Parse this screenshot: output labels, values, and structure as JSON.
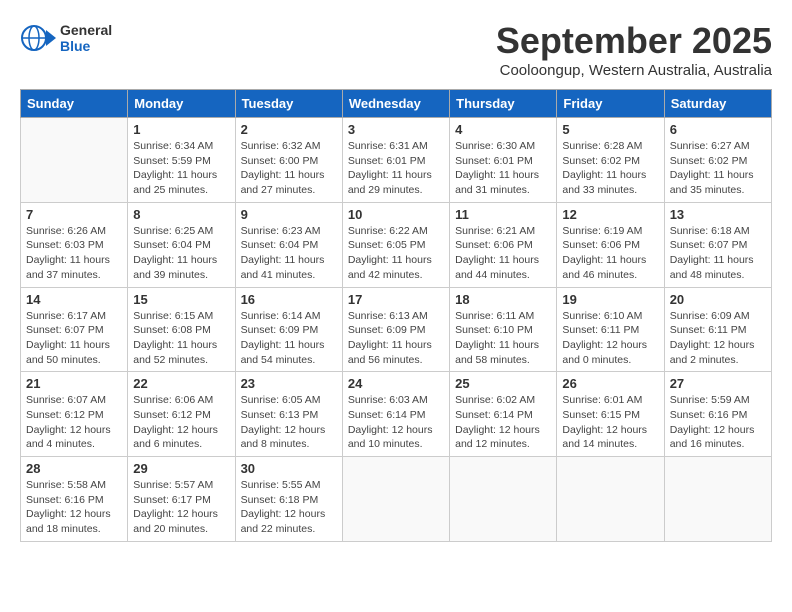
{
  "logo": {
    "text_general": "General",
    "text_blue": "Blue"
  },
  "header": {
    "month": "September 2025",
    "location": "Cooloongup, Western Australia, Australia"
  },
  "days_of_week": [
    "Sunday",
    "Monday",
    "Tuesday",
    "Wednesday",
    "Thursday",
    "Friday",
    "Saturday"
  ],
  "weeks": [
    [
      {
        "day": null,
        "data": null
      },
      {
        "day": "1",
        "data": "Sunrise: 6:34 AM\nSunset: 5:59 PM\nDaylight: 11 hours\nand 25 minutes."
      },
      {
        "day": "2",
        "data": "Sunrise: 6:32 AM\nSunset: 6:00 PM\nDaylight: 11 hours\nand 27 minutes."
      },
      {
        "day": "3",
        "data": "Sunrise: 6:31 AM\nSunset: 6:01 PM\nDaylight: 11 hours\nand 29 minutes."
      },
      {
        "day": "4",
        "data": "Sunrise: 6:30 AM\nSunset: 6:01 PM\nDaylight: 11 hours\nand 31 minutes."
      },
      {
        "day": "5",
        "data": "Sunrise: 6:28 AM\nSunset: 6:02 PM\nDaylight: 11 hours\nand 33 minutes."
      },
      {
        "day": "6",
        "data": "Sunrise: 6:27 AM\nSunset: 6:02 PM\nDaylight: 11 hours\nand 35 minutes."
      }
    ],
    [
      {
        "day": "7",
        "data": "Sunrise: 6:26 AM\nSunset: 6:03 PM\nDaylight: 11 hours\nand 37 minutes."
      },
      {
        "day": "8",
        "data": "Sunrise: 6:25 AM\nSunset: 6:04 PM\nDaylight: 11 hours\nand 39 minutes."
      },
      {
        "day": "9",
        "data": "Sunrise: 6:23 AM\nSunset: 6:04 PM\nDaylight: 11 hours\nand 41 minutes."
      },
      {
        "day": "10",
        "data": "Sunrise: 6:22 AM\nSunset: 6:05 PM\nDaylight: 11 hours\nand 42 minutes."
      },
      {
        "day": "11",
        "data": "Sunrise: 6:21 AM\nSunset: 6:06 PM\nDaylight: 11 hours\nand 44 minutes."
      },
      {
        "day": "12",
        "data": "Sunrise: 6:19 AM\nSunset: 6:06 PM\nDaylight: 11 hours\nand 46 minutes."
      },
      {
        "day": "13",
        "data": "Sunrise: 6:18 AM\nSunset: 6:07 PM\nDaylight: 11 hours\nand 48 minutes."
      }
    ],
    [
      {
        "day": "14",
        "data": "Sunrise: 6:17 AM\nSunset: 6:07 PM\nDaylight: 11 hours\nand 50 minutes."
      },
      {
        "day": "15",
        "data": "Sunrise: 6:15 AM\nSunset: 6:08 PM\nDaylight: 11 hours\nand 52 minutes."
      },
      {
        "day": "16",
        "data": "Sunrise: 6:14 AM\nSunset: 6:09 PM\nDaylight: 11 hours\nand 54 minutes."
      },
      {
        "day": "17",
        "data": "Sunrise: 6:13 AM\nSunset: 6:09 PM\nDaylight: 11 hours\nand 56 minutes."
      },
      {
        "day": "18",
        "data": "Sunrise: 6:11 AM\nSunset: 6:10 PM\nDaylight: 11 hours\nand 58 minutes."
      },
      {
        "day": "19",
        "data": "Sunrise: 6:10 AM\nSunset: 6:11 PM\nDaylight: 12 hours\nand 0 minutes."
      },
      {
        "day": "20",
        "data": "Sunrise: 6:09 AM\nSunset: 6:11 PM\nDaylight: 12 hours\nand 2 minutes."
      }
    ],
    [
      {
        "day": "21",
        "data": "Sunrise: 6:07 AM\nSunset: 6:12 PM\nDaylight: 12 hours\nand 4 minutes."
      },
      {
        "day": "22",
        "data": "Sunrise: 6:06 AM\nSunset: 6:12 PM\nDaylight: 12 hours\nand 6 minutes."
      },
      {
        "day": "23",
        "data": "Sunrise: 6:05 AM\nSunset: 6:13 PM\nDaylight: 12 hours\nand 8 minutes."
      },
      {
        "day": "24",
        "data": "Sunrise: 6:03 AM\nSunset: 6:14 PM\nDaylight: 12 hours\nand 10 minutes."
      },
      {
        "day": "25",
        "data": "Sunrise: 6:02 AM\nSunset: 6:14 PM\nDaylight: 12 hours\nand 12 minutes."
      },
      {
        "day": "26",
        "data": "Sunrise: 6:01 AM\nSunset: 6:15 PM\nDaylight: 12 hours\nand 14 minutes."
      },
      {
        "day": "27",
        "data": "Sunrise: 5:59 AM\nSunset: 6:16 PM\nDaylight: 12 hours\nand 16 minutes."
      }
    ],
    [
      {
        "day": "28",
        "data": "Sunrise: 5:58 AM\nSunset: 6:16 PM\nDaylight: 12 hours\nand 18 minutes."
      },
      {
        "day": "29",
        "data": "Sunrise: 5:57 AM\nSunset: 6:17 PM\nDaylight: 12 hours\nand 20 minutes."
      },
      {
        "day": "30",
        "data": "Sunrise: 5:55 AM\nSunset: 6:18 PM\nDaylight: 12 hours\nand 22 minutes."
      },
      {
        "day": null,
        "data": null
      },
      {
        "day": null,
        "data": null
      },
      {
        "day": null,
        "data": null
      },
      {
        "day": null,
        "data": null
      }
    ]
  ]
}
